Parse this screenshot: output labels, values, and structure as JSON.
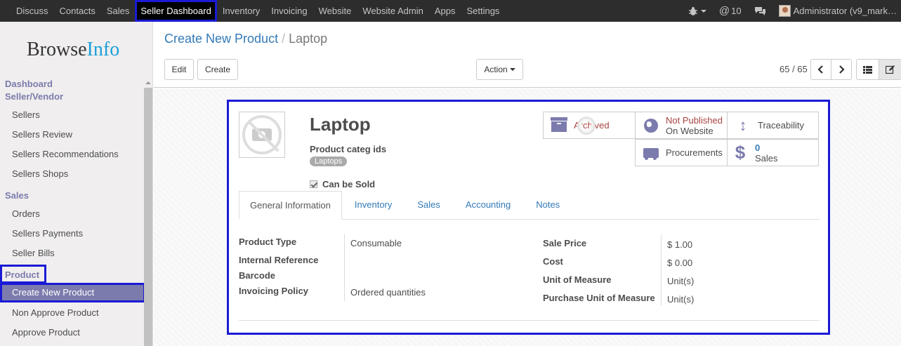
{
  "topnav": {
    "menu": [
      "Discuss",
      "Contacts",
      "Sales",
      "Seller Dashboard",
      "Inventory",
      "Invoicing",
      "Website",
      "Website Admin",
      "Apps",
      "Settings"
    ],
    "active": "Seller Dashboard",
    "messages_count": "10",
    "user": "Administrator (v9_mark…"
  },
  "sidebar": {
    "logo_browse": "Browse",
    "logo_info": "Info",
    "sections": [
      {
        "title": "Dashboard",
        "items": []
      },
      {
        "title": "Seller/Vendor",
        "items": [
          "Sellers",
          "Sellers Review",
          "Sellers Recommendations",
          "Sellers Shops"
        ]
      },
      {
        "title": "Sales",
        "items": [
          "Orders",
          "Sellers Payments",
          "Seller Bills"
        ]
      },
      {
        "title": "Product",
        "items": [
          "Create New Product",
          "Non Approve Product",
          "Approve Product"
        ]
      }
    ],
    "active_item": "Create New Product"
  },
  "control": {
    "breadcrumb_parent": "Create New Product",
    "breadcrumb_sep": "/",
    "breadcrumb_current": "Laptop",
    "edit": "Edit",
    "create": "Create",
    "action": "Action",
    "pager": "65 / 65"
  },
  "form": {
    "name": "Laptop",
    "categ_label": "Product categ ids",
    "categ_tag": "Laptops",
    "can_be_sold": "Can be Sold",
    "smart_buttons": {
      "archived": "Archived",
      "published_1": "Not Published",
      "published_2": "On Website",
      "traceability": "Traceability",
      "procurements": "Procurements",
      "sales_count": "0",
      "sales_label": "Sales"
    },
    "tabs": [
      "General Information",
      "Inventory",
      "Sales",
      "Accounting",
      "Notes"
    ],
    "left_fields": {
      "product_type_label": "Product Type",
      "product_type_value": "Consumable",
      "internal_ref_label": "Internal Reference",
      "barcode_label": "Barcode",
      "invoicing_policy_label": "Invoicing Policy",
      "invoicing_policy_value": "Ordered quantities"
    },
    "right_fields": {
      "sale_price_label": "Sale Price",
      "sale_price_value": "$ 1.00",
      "cost_label": "Cost",
      "cost_value": "$ 0.00",
      "uom_label": "Unit of Measure",
      "uom_value": "Unit(s)",
      "purchase_uom_label": "Purchase Unit of Measure",
      "purchase_uom_value": "Unit(s)"
    }
  },
  "colors": {
    "nav_bg": "#2d2d2d",
    "accent": "#7c7bad",
    "link": "#337ab7",
    "highlight_box": "#1a1ad6"
  }
}
